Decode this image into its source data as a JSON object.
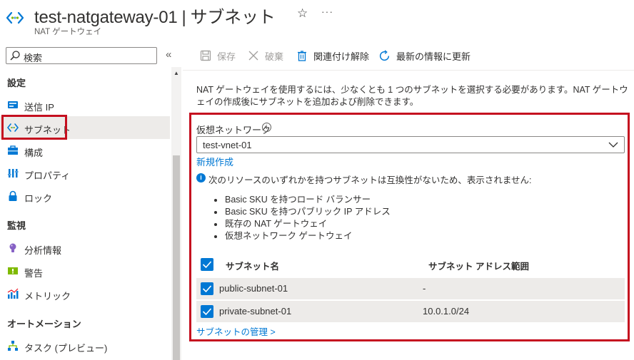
{
  "header": {
    "resource_name": "test-natgateway-01",
    "separator": "|",
    "blade_name": "サブネット",
    "subtitle": "NAT ゲートウェイ",
    "more": "···"
  },
  "sidebar": {
    "search_placeholder": "検索",
    "collapse": "«",
    "sections": [
      {
        "title": "設定",
        "items": [
          {
            "label": "送信 IP",
            "icon": "outbound-ip-icon"
          },
          {
            "label": "サブネット",
            "icon": "subnet-icon",
            "active": true
          },
          {
            "label": "構成",
            "icon": "configuration-icon"
          },
          {
            "label": "プロパティ",
            "icon": "properties-icon"
          },
          {
            "label": "ロック",
            "icon": "lock-icon"
          }
        ]
      },
      {
        "title": "監視",
        "items": [
          {
            "label": "分析情報",
            "icon": "insights-icon"
          },
          {
            "label": "警告",
            "icon": "alerts-icon"
          },
          {
            "label": "メトリック",
            "icon": "metrics-icon"
          }
        ]
      },
      {
        "title": "オートメーション",
        "items": [
          {
            "label": "タスク (プレビュー)",
            "icon": "tasks-icon"
          }
        ]
      }
    ]
  },
  "toolbar": {
    "save": "保存",
    "discard": "破棄",
    "disassociate": "関連付け解除",
    "refresh": "最新の情報に更新"
  },
  "content": {
    "intro": "NAT ゲートウェイを使用するには、少なくとも 1 つのサブネットを選択する必要があります。NAT ゲートウェイの作成後にサブネットを追加および削除できます。",
    "vnet_label": "仮想ネットワーク",
    "vnet_value": "test-vnet-01",
    "create_new": "新規作成",
    "notice": "次のリソースのいずれかを持つサブネットは互換性がないため、表示されません:",
    "bullets": [
      "Basic SKU を持つロード バランサー",
      "Basic SKU を持つパブリック IP アドレス",
      "既存の NAT ゲートウェイ",
      "仮想ネットワーク ゲートウェイ"
    ],
    "table": {
      "col_name": "サブネット名",
      "col_range": "サブネット アドレス範囲",
      "rows": [
        {
          "name": "public-subnet-01",
          "range": "-"
        },
        {
          "name": "private-subnet-01",
          "range": "10.0.1.0/24"
        }
      ]
    },
    "manage_link": "サブネットの管理 >"
  },
  "colors": {
    "accent": "#0078d4",
    "highlight": "#c50f1f",
    "row_bg": "#edebe9"
  }
}
